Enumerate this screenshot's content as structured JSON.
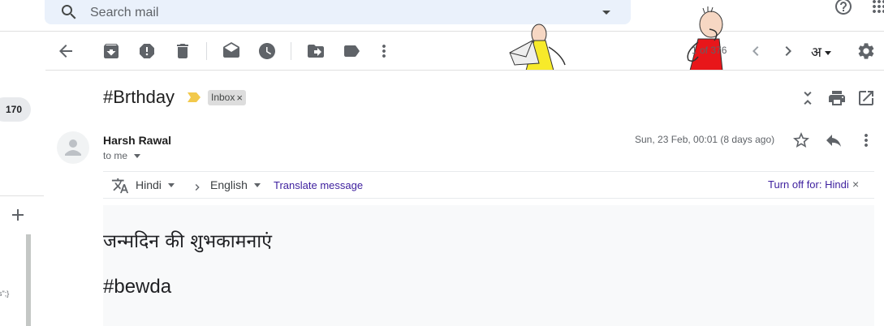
{
  "search": {
    "placeholder": "Search mail"
  },
  "toolbar": {
    "pagination": "1 of 376",
    "input_tool_label": "अ"
  },
  "sidebar": {
    "unread_count": "170",
    "snippet": "s\";}"
  },
  "email": {
    "subject": "#Brthday",
    "label_chip": "Inbox",
    "chip_close": "×",
    "sender_name": "Harsh Rawal",
    "recipient": "to me",
    "date": "Sun, 23 Feb, 00:01 (8 days ago)",
    "body": [
      "जन्मदिन की शुभकामनाएं",
      "#bewda"
    ]
  },
  "translate": {
    "source_language": "Hindi",
    "target_language": "English",
    "translate_link": "Translate message",
    "turn_off_label": "Turn off for: Hindi",
    "close": "×"
  },
  "colors": {
    "accent_link": "#3d1f9e",
    "search_bg": "#eaf1fb",
    "importance": "#f2c94c",
    "body_bg": "#f8f9fa"
  },
  "icons": [
    "search-icon",
    "dropdown-icon",
    "help-icon",
    "apps-icon",
    "back-icon",
    "archive-icon",
    "report-spam-icon",
    "delete-icon",
    "mark-unread-icon",
    "snooze-icon",
    "move-to-icon",
    "label-icon",
    "more-icon",
    "prev-icon",
    "next-icon",
    "settings-icon",
    "collapse-icon",
    "print-icon",
    "new-window-icon",
    "star-icon",
    "reply-icon",
    "translate-icon",
    "add-icon"
  ]
}
